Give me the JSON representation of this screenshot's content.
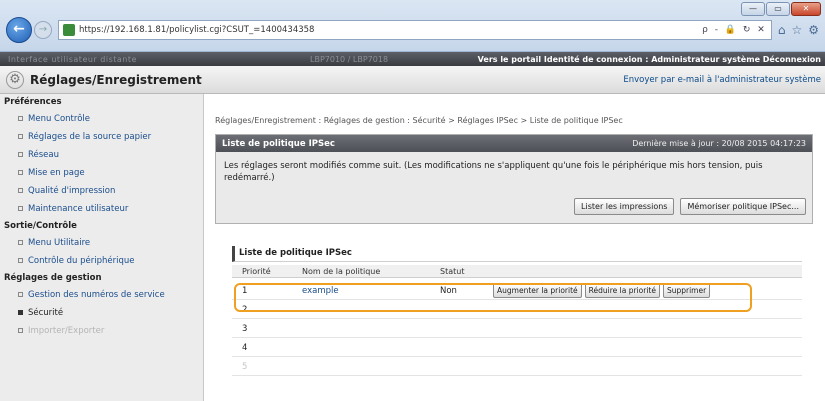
{
  "browser": {
    "url": "https://192.168.1.81/policylist.cgi?CSUT_=1400434358",
    "address_tools": "ρ - 🔒 ↻ ✕",
    "window_buttons": [
      "—",
      "▭",
      "✕"
    ]
  },
  "topbar": {
    "left_text": "Interface utilisateur distante",
    "mid_text": "LBP7010 / LBP7018",
    "links": "Vers le portail  Identité de connexion : Administrateur système  Déconnexion"
  },
  "title": {
    "app_title": "Réglages/Enregistrement",
    "email_link": "Envoyer par e-mail à l'administrateur système"
  },
  "sidebar": {
    "sections": [
      {
        "header": "Préférences",
        "items": [
          "Menu Contrôle",
          "Réglages de la source papier",
          "Réseau",
          "Mise en page",
          "Qualité d'impression",
          "Maintenance utilisateur"
        ]
      },
      {
        "header": "Sortie/Contrôle",
        "items": [
          "Menu Utilitaire",
          "Contrôle du périphérique"
        ]
      },
      {
        "header": "Réglages de gestion",
        "items": [
          "Gestion des numéros de service",
          "Sécurité",
          "Importer/Exporter"
        ]
      }
    ]
  },
  "main": {
    "breadcrumb": "Réglages/Enregistrement : Réglages de gestion : Sécurité > Réglages IPSec > Liste de politique IPSec",
    "panel": {
      "title": "Liste de politique IPSec",
      "date": "Dernière mise à jour : 20/08 2015 04:17:23",
      "message": "Les réglages seront modifiés comme suit. (Les modifications ne s'appliquent qu'une fois le périphérique mis hors tension, puis redémarré.)",
      "btn_print": "Lister les impressions",
      "btn_save": "Mémoriser politique IPSec..."
    },
    "list": {
      "title": "Liste de politique IPSec",
      "headers": {
        "priority": "Priorité",
        "name": "Nom de la politique",
        "status": "Statut"
      },
      "rows": [
        {
          "priority": "1",
          "name": "example",
          "status": "Non"
        },
        {
          "priority": "2",
          "name": "",
          "status": ""
        },
        {
          "priority": "3",
          "name": "",
          "status": ""
        },
        {
          "priority": "4",
          "name": "",
          "status": ""
        },
        {
          "priority": "5",
          "name": "",
          "status": ""
        }
      ],
      "actions": {
        "raise": "Augmenter la priorité",
        "lower": "Réduire la priorité",
        "delete": "Supprimer"
      }
    }
  },
  "colors": {
    "highlight": "#f0a020",
    "link": "#1a4d8c",
    "header_dark": "#4d5056"
  }
}
